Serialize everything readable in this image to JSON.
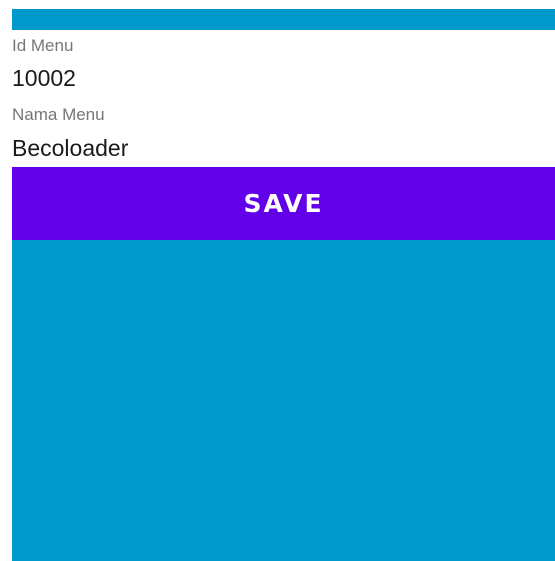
{
  "colors": {
    "background": "#0099cc",
    "form_background": "#ffffff",
    "primary_button": "#6200ea",
    "label_text": "#777777",
    "value_text": "#1a1a1a"
  },
  "form": {
    "id_menu": {
      "label": "Id Menu",
      "value": "10002"
    },
    "nama_menu": {
      "label": "Nama Menu",
      "value": "Becoloader"
    }
  },
  "actions": {
    "save_label": "SAVE"
  }
}
